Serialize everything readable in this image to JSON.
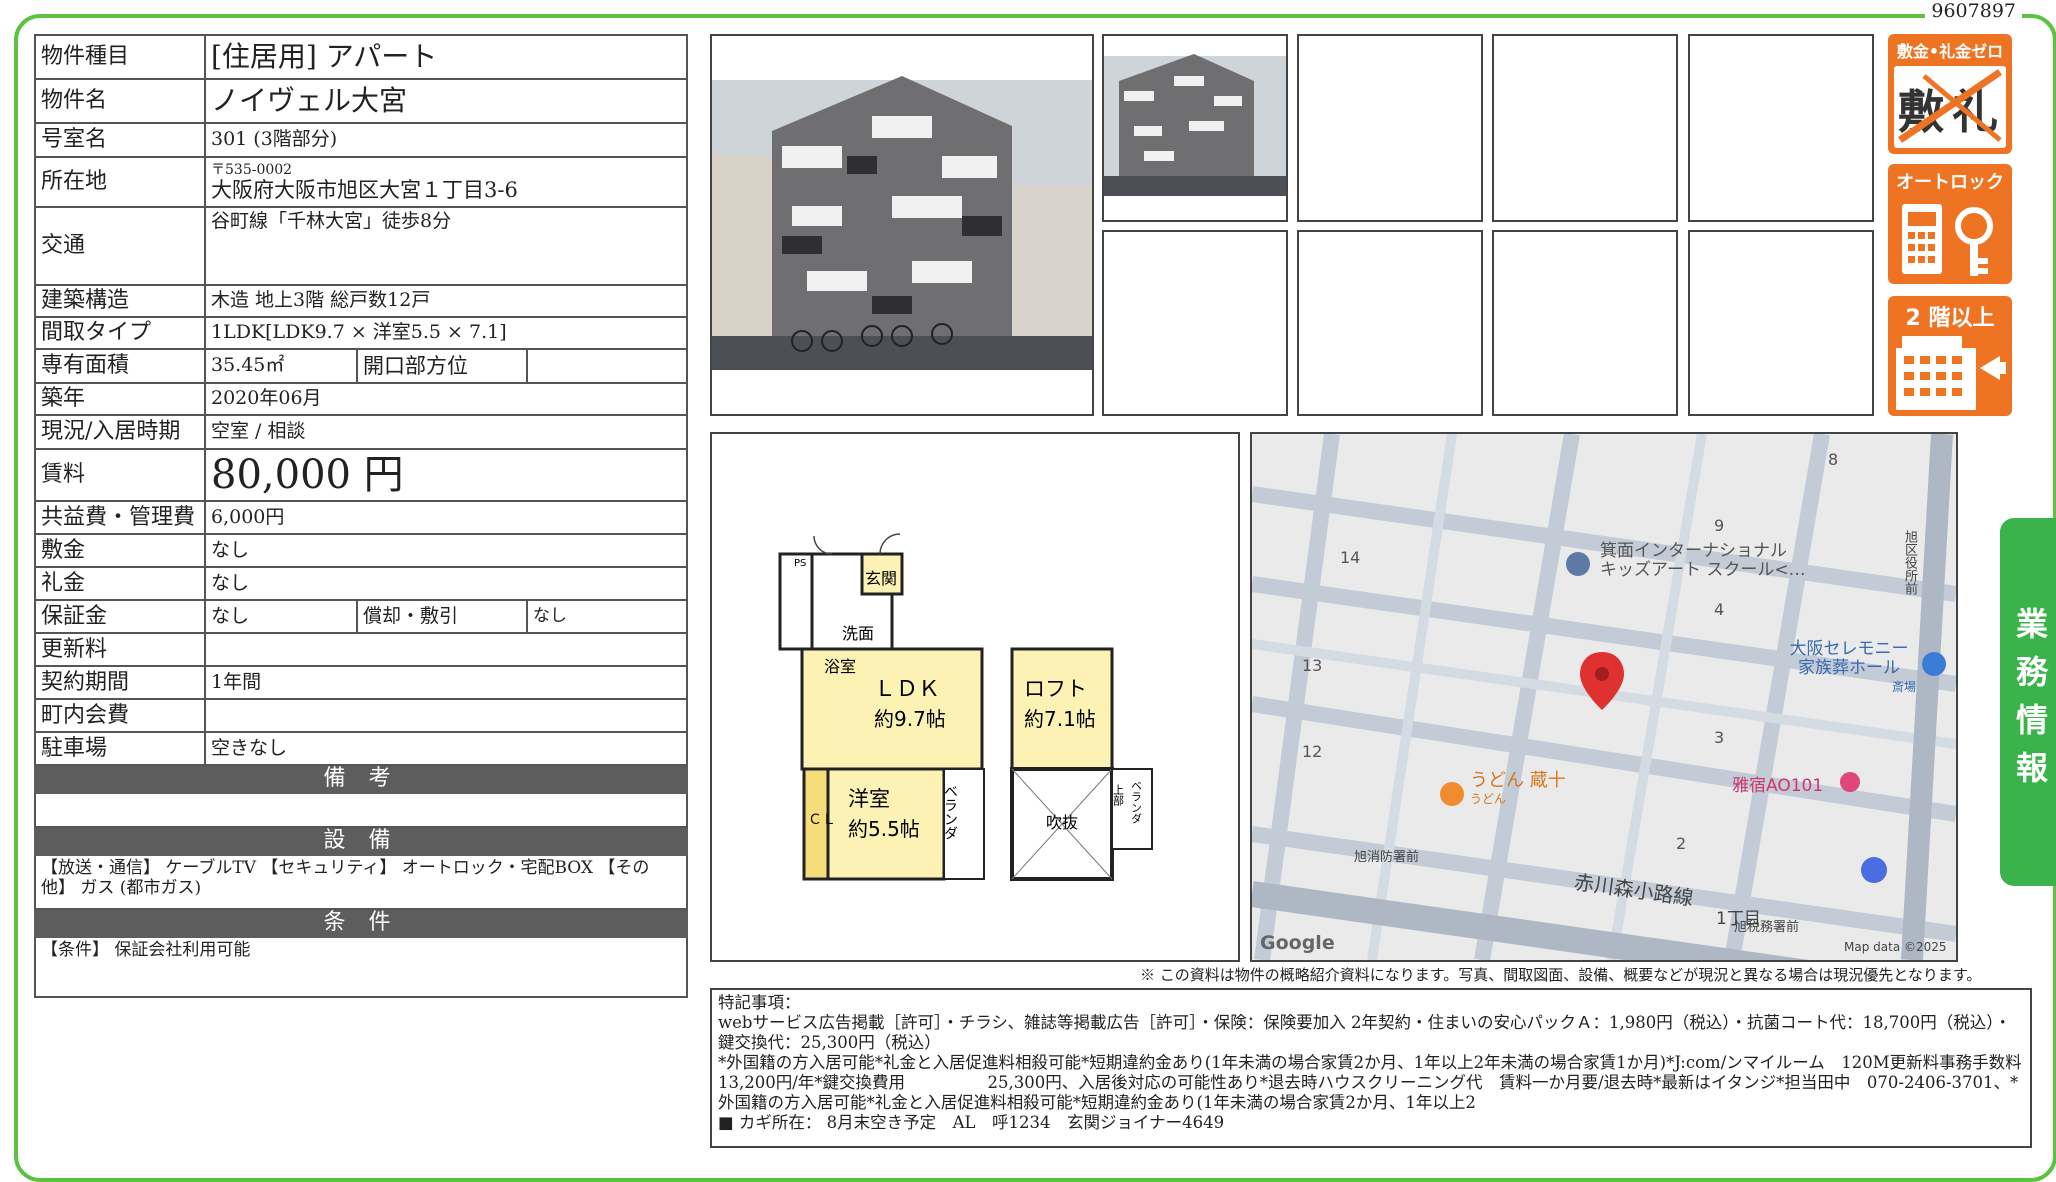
{
  "doc_id": "9607897",
  "rows": {
    "type_label": "物件種目",
    "type_value": "[住居用] アパート",
    "name_label": "物件名",
    "name_value": "ノイヴェル大宮",
    "room_label": "号室名",
    "room_value": "301 (3階部分)",
    "address_label": "所在地",
    "address_zip": "〒535-0002",
    "address_value": "大阪府大阪市旭区大宮１丁目3-6",
    "transit_label": "交通",
    "transit_value": "谷町線「千林大宮」徒歩8分",
    "structure_label": "建築構造",
    "structure_value": "木造 地上3階 総戸数12戸",
    "layout_label": "間取タイプ",
    "layout_value": "1LDK[LDK9.7 × 洋室5.5 × 7.1]",
    "area_label": "専有面積",
    "area_value": "35.45㎡",
    "direction_label": "開口部方位",
    "direction_value": "",
    "built_label": "築年",
    "built_value": "2020年06月",
    "status_label": "現況/入居時期",
    "status_value": "空室 / 相談",
    "rent_label": "賃料",
    "rent_value": "80,000 円",
    "fee_label": "共益費・管理費",
    "fee_value": "6,000円",
    "deposit_label": "敷金",
    "deposit_value": "なし",
    "keymoney_label": "礼金",
    "keymoney_value": "なし",
    "guarantee_label": "保証金",
    "guarantee_value": "なし",
    "amort_label": "償却・敷引",
    "amort_value": "なし",
    "renewal_label": "更新料",
    "renewal_value": "",
    "term_label": "契約期間",
    "term_value": "1年間",
    "community_label": "町内会費",
    "community_value": "",
    "parking_label": "駐車場",
    "parking_value": "空きなし"
  },
  "sections": {
    "remarks_title": "備 考",
    "remarks_text": "",
    "equipment_title": "設 備",
    "equipment_text": "【放送・通信】 ケーブルTV 【セキュリティ】 オートロック・宅配BOX 【その他】 ガス (都市ガス)",
    "conditions_title": "条 件",
    "conditions_text": "【条件】 保証会社利用可能"
  },
  "badges": {
    "zero": "敷金•礼金ゼロ",
    "zero_shiki": "敷",
    "zero_rei": "礼",
    "autolock": "オートロック",
    "floor2": "2 階以上"
  },
  "sidetab": "業務情報",
  "floorplan": {
    "ps": "PS",
    "genkan": "玄関",
    "sennaku": "洗面",
    "yokushitsu": "浴室",
    "ldk": "ＬＤＫ",
    "ldk_size": "約9.7帖",
    "yoshitsu": "洋室",
    "yoshitsu_size": "約5.5帖",
    "cl": "ＣＬ",
    "veranda": "ベランダ",
    "loft": "ロフト",
    "loft_size": "約7.1帖",
    "fukinuke": "吹抜",
    "joubu": "上部",
    "veranda2": "ベランダ"
  },
  "map": {
    "school": "箕面インターナショナル",
    "school2": "キッズアート スクール<…",
    "ceremony": "大阪セレモニー",
    "ceremony2": "家族葬ホール",
    "ceremony3": "斎場",
    "udon": "うどん 蔵十",
    "udon2": "うどん",
    "hotel": "雅宿AO101",
    "fire": "旭消防署前",
    "tax": "旭税務署前",
    "road": "赤川森小路線",
    "road2": "旭区役所前",
    "chome": "1丁目",
    "n8": "8",
    "n9": "9",
    "n14": "14",
    "n4": "4",
    "n13": "13",
    "n3": "3",
    "n12": "12",
    "n2": "2",
    "google": "Google",
    "mapdata": "Map data ©2025"
  },
  "disclaimer": "※ この資料は物件の概略紹介資料になります。写真、間取図面、設備、概要などが現況と異なる場合は現況優先となります。",
  "special": {
    "title": "特記事項：",
    "line1": "webサービス広告掲載［許可］・チラシ、雑誌等掲載広告［許可］・保険：保険要加入 2年契約・住まいの安心パックＡ：1,980円（税込）・抗菌コート代：18,700円（税込）・鍵交換代：25,300円（税込）",
    "line2": "*外国籍の方入居可能*礼金と入居促進料相殺可能*短期違約金あり(1年未満の場合家賃2か月、1年以上2年未満の場合家賃1か月)*J:com/ンマイルーム　120M更新料事務手数料　　13,200円/年*鍵交換費用　　　　　25,300円、入居後対応の可能性あり*退去時ハウスクリーニング代　賃料一か月要/退去時*最新はイタンジ*担当田中　070-2406-3701、*外国籍の方入居可能*礼金と入居促進料相殺可能*短期違約金あり(1年未満の場合家賃2か月、1年以上2",
    "line3": "■ カギ所在： 8月末空き予定　AL　呼1234　玄関ジョイナー4649"
  }
}
